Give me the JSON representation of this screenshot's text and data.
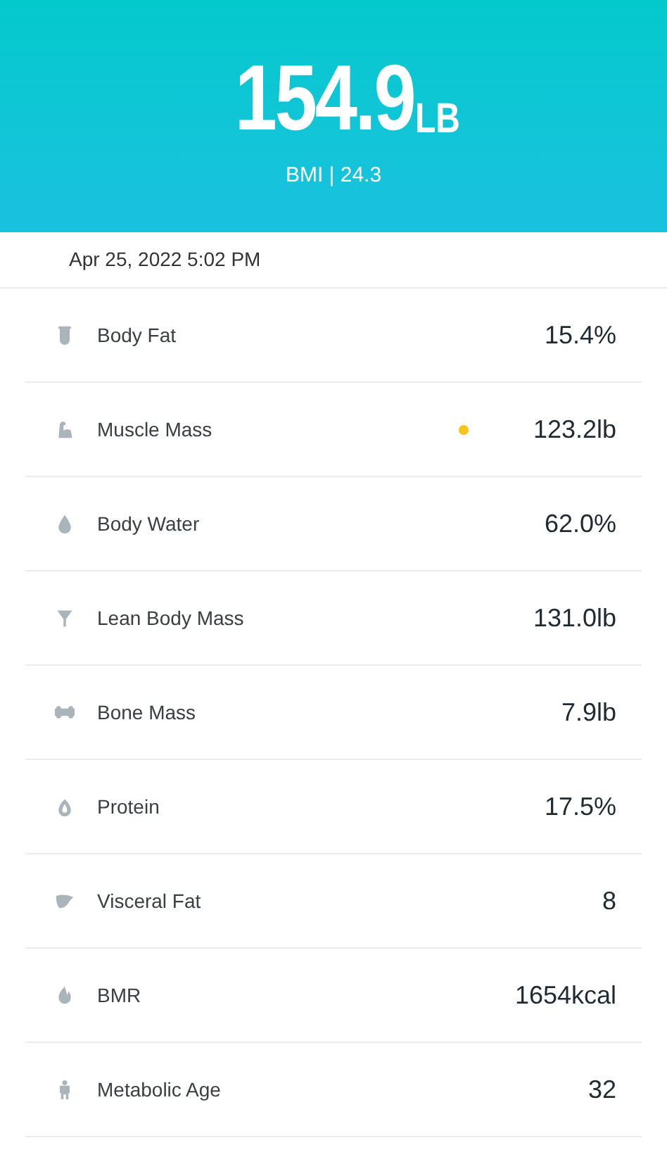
{
  "header": {
    "weight": "154.9",
    "unit": "LB",
    "bmi": "BMI | 24.3"
  },
  "timestamp": "Apr 25, 2022 5:02 PM",
  "metrics": [
    {
      "label": "Body Fat",
      "value": "15.4%",
      "indicator": false
    },
    {
      "label": "Muscle Mass",
      "value": "123.2lb",
      "indicator": true
    },
    {
      "label": "Body Water",
      "value": "62.0%",
      "indicator": false
    },
    {
      "label": "Lean Body Mass",
      "value": "131.0lb",
      "indicator": false
    },
    {
      "label": "Bone Mass",
      "value": "7.9lb",
      "indicator": false
    },
    {
      "label": "Protein",
      "value": "17.5%",
      "indicator": false
    },
    {
      "label": "Visceral Fat",
      "value": "8",
      "indicator": false
    },
    {
      "label": "BMR",
      "value": "1654kcal",
      "indicator": false
    },
    {
      "label": "Metabolic Age",
      "value": "32",
      "indicator": false
    }
  ]
}
